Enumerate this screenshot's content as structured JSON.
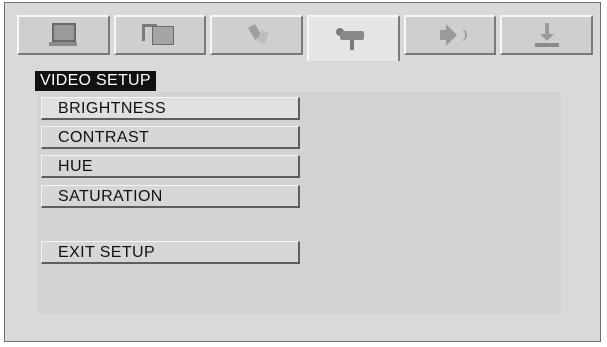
{
  "tabs": [
    {
      "icon": "monitor-icon"
    },
    {
      "icon": "language-icon"
    },
    {
      "icon": "audio-output-icon"
    },
    {
      "icon": "video-camera-icon",
      "active": true
    },
    {
      "icon": "speaker-icon"
    },
    {
      "icon": "preference-icon"
    }
  ],
  "menu": {
    "title": "VIDEO SETUP",
    "items": [
      {
        "label": "BRIGHTNESS"
      },
      {
        "label": "CONTRAST"
      },
      {
        "label": "HUE"
      },
      {
        "label": "SATURATION"
      }
    ],
    "exit_label": "EXIT  SETUP"
  },
  "colors": {
    "background": "#d9d9d9",
    "title_bg": "#111111",
    "title_text": "#ffffff"
  }
}
